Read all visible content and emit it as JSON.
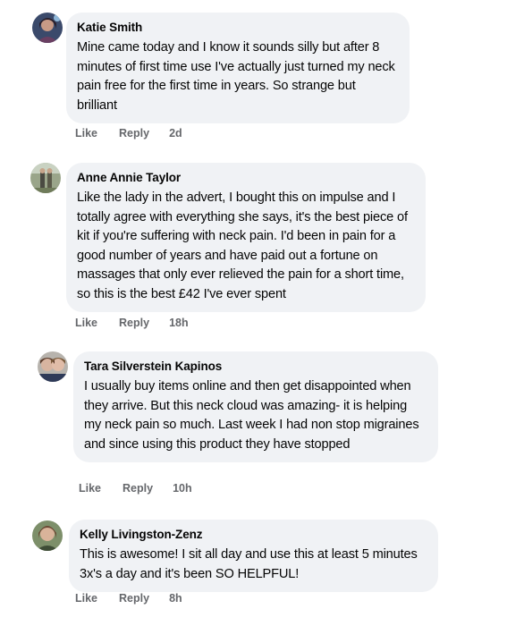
{
  "comments": [
    {
      "author": "Katie Smith",
      "text": "Mine came today and I know it sounds silly but after 8 minutes of first time use I've actually just turned my neck pain free for the first time in years. So strange but brilliant",
      "like_label": "Like",
      "reply_label": "Reply",
      "timestamp": "2d"
    },
    {
      "author": "Anne Annie Taylor",
      "text": "Like the lady in the advert, I bought this on impulse and I totally agree with everything she says, it's the best piece of kit if you're suffering with neck pain. I'd been in pain for a good number of years and have paid out a fortune on massages that only ever relieved the pain for a short time, so this is the best £42 I've ever spent",
      "like_label": "Like",
      "reply_label": "Reply",
      "timestamp": "18h"
    },
    {
      "author": "Tara Silverstein Kapinos",
      "text": "I usually buy items online and then get disappointed when they arrive. But this neck cloud was amazing- it is helping my neck pain so much. Last week I had non stop migraines and since using this product they have stopped",
      "like_label": "Like",
      "reply_label": "Reply",
      "timestamp": "10h"
    },
    {
      "author": "Kelly Livingston-Zenz",
      "text": "This is awesome! I sit all day and use this at least 5 minutes 3x's a day and it's been SO HELPFUL!",
      "like_label": "Like",
      "reply_label": "Reply",
      "timestamp": "8h"
    }
  ]
}
